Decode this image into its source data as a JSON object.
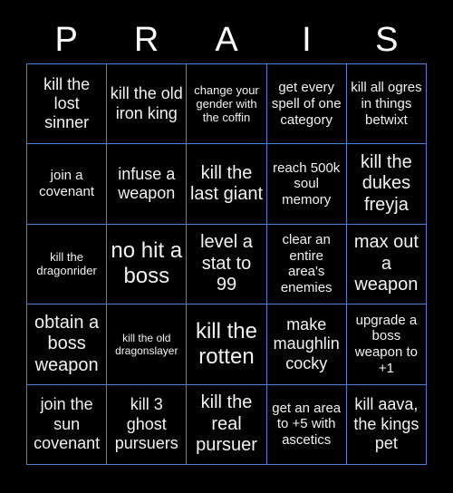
{
  "board": {
    "background_color": "#000000",
    "grid_line_color": "#4a7fd4",
    "text_color": "#f2f2f2",
    "header_text_color": "#ffffff",
    "columns": 5,
    "rows": 5
  },
  "header": {
    "title": "PRAIS",
    "letters": [
      "P",
      "R",
      "A",
      "I",
      "S"
    ]
  },
  "cells": [
    {
      "id": "r1c1",
      "text": "kill the lost sinner",
      "size": "fs-l"
    },
    {
      "id": "r1c2",
      "text": "kill the old iron king",
      "size": "fs-l"
    },
    {
      "id": "r1c3",
      "text": "change your gender with the coffin",
      "size": "fs-s"
    },
    {
      "id": "r1c4",
      "text": "get every spell of one category",
      "size": "fs-m"
    },
    {
      "id": "r1c5",
      "text": "kill all ogres in things betwixt",
      "size": "fs-m"
    },
    {
      "id": "r2c1",
      "text": "join a covenant",
      "size": "fs-m"
    },
    {
      "id": "r2c2",
      "text": "infuse a weapon",
      "size": "fs-l"
    },
    {
      "id": "r2c3",
      "text": "kill the last giant",
      "size": "fs-xl"
    },
    {
      "id": "r2c4",
      "text": "reach 500k soul memory",
      "size": "fs-m"
    },
    {
      "id": "r2c5",
      "text": "kill the dukes freyja",
      "size": "fs-xl"
    },
    {
      "id": "r3c1",
      "text": "kill the dragonrider",
      "size": "fs-s"
    },
    {
      "id": "r3c2",
      "text": "no hit a boss",
      "size": "fs-xxl"
    },
    {
      "id": "r3c3",
      "text": "level a stat to 99",
      "size": "fs-xl"
    },
    {
      "id": "r3c4",
      "text": "clear an entire area's enemies",
      "size": "fs-m"
    },
    {
      "id": "r3c5",
      "text": "max out a weapon",
      "size": "fs-xl"
    },
    {
      "id": "r4c1",
      "text": "obtain a boss weapon",
      "size": "fs-xl"
    },
    {
      "id": "r4c2",
      "text": "kill the old dragonslayer",
      "size": "fs-xs"
    },
    {
      "id": "r4c3",
      "text": "kill the rotten",
      "size": "fs-xxl"
    },
    {
      "id": "r4c4",
      "text": "make maughlin cocky",
      "size": "fs-l"
    },
    {
      "id": "r4c5",
      "text": "upgrade a boss weapon to +1",
      "size": "fs-m"
    },
    {
      "id": "r5c1",
      "text": "join the sun covenant",
      "size": "fs-l"
    },
    {
      "id": "r5c2",
      "text": "kill 3 ghost pursuers",
      "size": "fs-l"
    },
    {
      "id": "r5c3",
      "text": "kill the real pursuer",
      "size": "fs-xl"
    },
    {
      "id": "r5c4",
      "text": "get an area to +5 with ascetics",
      "size": "fs-m"
    },
    {
      "id": "r5c5",
      "text": "kill aava, the kings pet",
      "size": "fs-l"
    }
  ]
}
